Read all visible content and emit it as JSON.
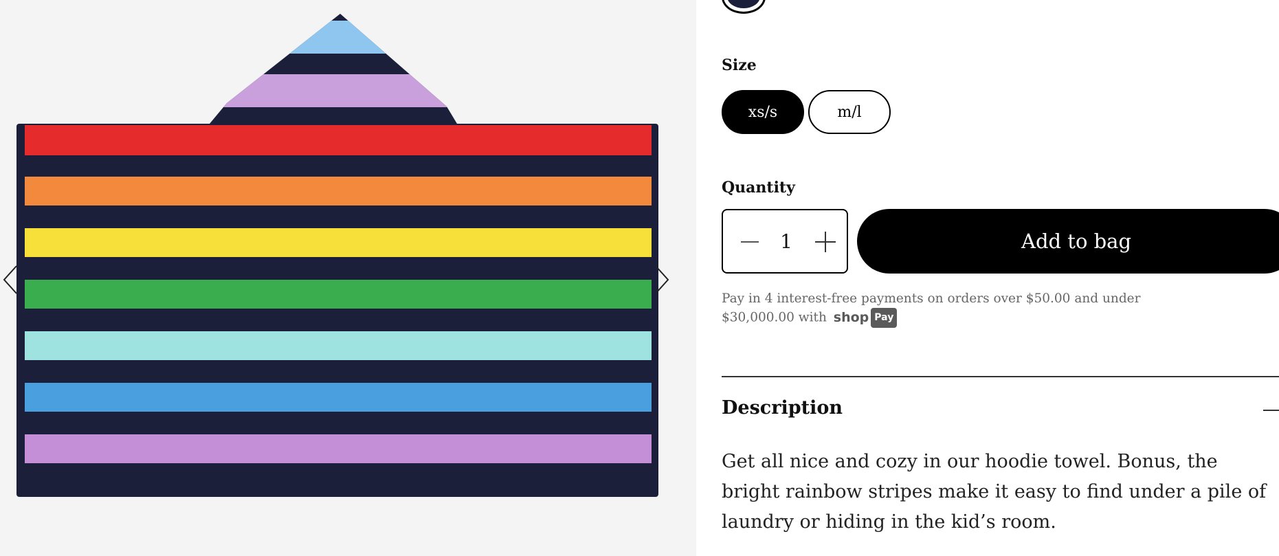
{
  "product": {
    "image_alt": "Rainbow stripe hoodie towel",
    "stripe_colors": [
      "#e52b2b",
      "#f2893c",
      "#f8e03a",
      "#3aae4f",
      "#9fe3e0",
      "#4a9fde",
      "#c48fd6"
    ],
    "base_color": "#1b1f3a",
    "hood_stripes": [
      "#8ec6ef",
      "#1b1f3a",
      "#c9a0dc",
      "#1b1f3a"
    ]
  },
  "size": {
    "label": "Size",
    "options": [
      "xs/s",
      "m/l"
    ],
    "selected": "xs/s"
  },
  "quantity": {
    "label": "Quantity",
    "value": "1"
  },
  "cart": {
    "add_label": "Add to bag"
  },
  "payment": {
    "text": "Pay in 4 interest-free payments on orders over $50.00 and under $30,000.00 with",
    "brand": "shop",
    "brand_badge": "Pay"
  },
  "description": {
    "title": "Description",
    "body": "Get all nice and cozy in our hoodie towel. Bonus, the bright rainbow stripes make it easy to find under a pile of laundry or hiding in the kid’s room."
  }
}
